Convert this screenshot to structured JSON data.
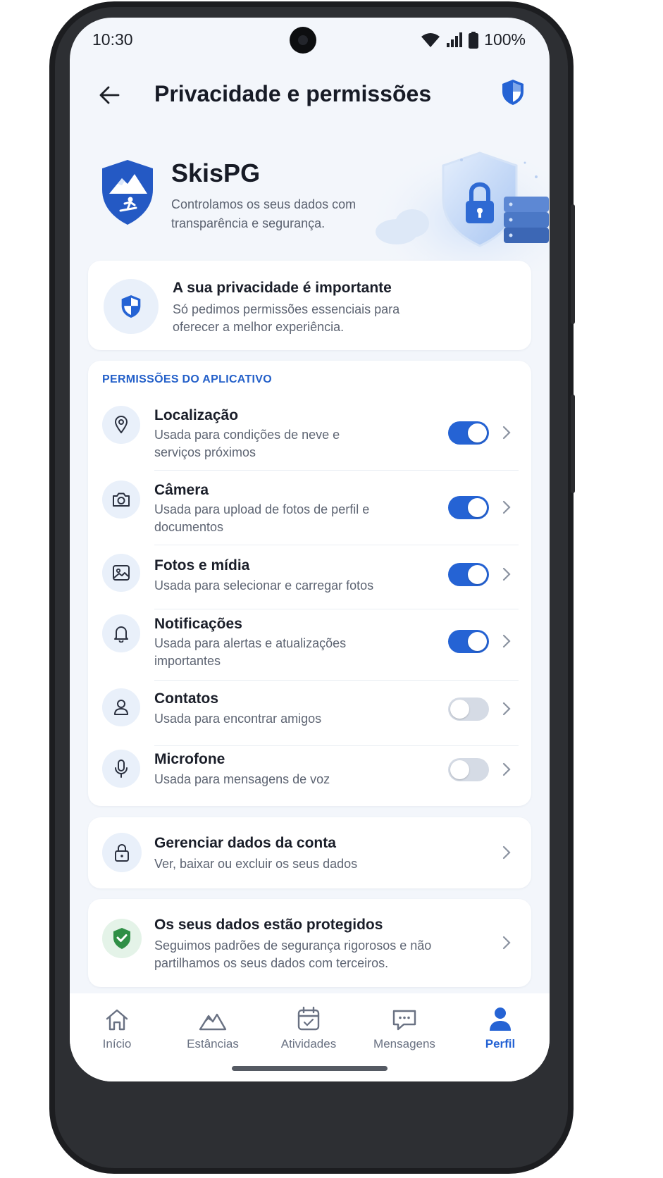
{
  "status_bar": {
    "time": "10:30",
    "battery": "100%",
    "icons": [
      "wifi-icon",
      "signal-icon",
      "battery-icon"
    ]
  },
  "header": {
    "title": "Privacidade e permissões",
    "back_icon": "arrow-left-icon",
    "right_icon": "shield-icon"
  },
  "hero": {
    "app_name": "SkisPG",
    "description": "Controlamos os seus dados com transparência e segurança."
  },
  "privacy_card": {
    "title": "A sua privacidade é importante",
    "subtitle": "Só pedimos permissões essenciais para oferecer a melhor experiência."
  },
  "permissions": {
    "section_label": "PERMISSÕES DO APLICATIVO",
    "items": [
      {
        "title": "Localização",
        "subtitle": "Usada para condições de neve e serviços próximos",
        "enabled": true,
        "icon": "location-pin-icon"
      },
      {
        "title": "Câmera",
        "subtitle": "Usada para upload de fotos de perfil e documentos",
        "enabled": true,
        "icon": "camera-icon"
      },
      {
        "title": "Fotos e mídia",
        "subtitle": "Usada para selecionar e carregar fotos",
        "enabled": true,
        "icon": "image-icon"
      },
      {
        "title": "Notificações",
        "subtitle": "Usada para alertas e atualizações importantes",
        "enabled": true,
        "icon": "bell-icon"
      },
      {
        "title": "Contatos",
        "subtitle": "Usada para encontrar amigos",
        "enabled": false,
        "icon": "person-icon"
      },
      {
        "title": "Microfone",
        "subtitle": "Usada para mensagens de voz",
        "enabled": false,
        "icon": "microphone-icon"
      }
    ]
  },
  "account_card": {
    "title": "Gerenciar dados da conta",
    "subtitle": "Ver, baixar ou excluir os seus dados"
  },
  "protected_card": {
    "title": "Os seus dados estão protegidos",
    "subtitle": "Seguimos padrões de segurança rigorosos e não partilhamos os seus dados com terceiros."
  },
  "bottom_nav": {
    "items": [
      {
        "label": "Início",
        "icon": "home-icon",
        "active": false
      },
      {
        "label": "Estâncias",
        "icon": "mountain-icon",
        "active": false
      },
      {
        "label": "Atividades",
        "icon": "calendar-icon",
        "active": false
      },
      {
        "label": "Mensagens",
        "icon": "chat-icon",
        "active": false
      },
      {
        "label": "Perfil",
        "icon": "profile-icon",
        "active": true
      }
    ]
  },
  "colors": {
    "accent": "#2563d4",
    "background": "#f3f6fb",
    "success": "#2f8f46"
  }
}
